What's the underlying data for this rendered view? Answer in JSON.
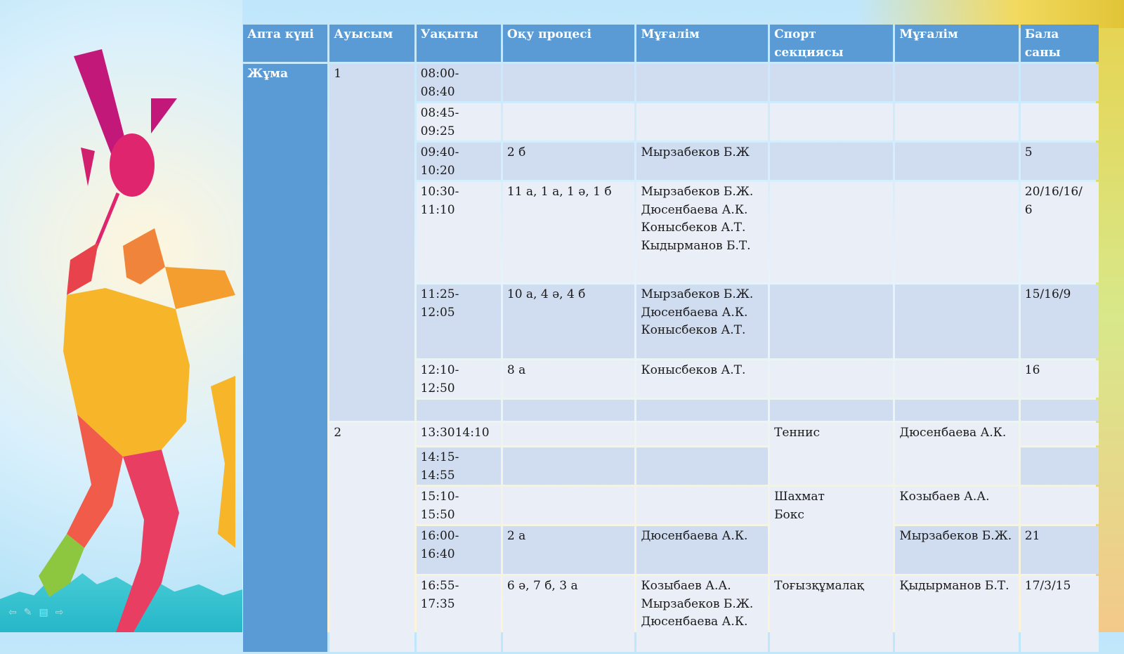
{
  "table": {
    "headers": [
      "Апта күні",
      "Ауысым",
      "Уақыты",
      "Оқу процесі",
      "Мұғалім",
      "Спорт секциясы",
      "Мұғалім",
      "Бала саны"
    ],
    "day": "Жұма",
    "shift1": "1",
    "shift2": "2",
    "rows": [
      {
        "time": "08:00-\n08:40",
        "group": "",
        "teacher": "",
        "count": ""
      },
      {
        "time": "08:45-\n09:25",
        "group": "",
        "teacher": "",
        "count": ""
      },
      {
        "time": "09:40-\n10:20",
        "group": "2 б",
        "teacher": "Мырзабеков Б.Ж",
        "count": "5"
      },
      {
        "time": "10:30-\n11:10",
        "group": "11 а, 1 а, 1 ә, 1 б",
        "teacher": "Мырзабеков Б.Ж.\nДюсенбаева А.К.\nКонысбеков А.Т.\nКыдырманов Б.Т.",
        "count": "20/16/16/\n6"
      },
      {
        "time": "11:25-\n12:05",
        "group": "10 а, 4 ә, 4 б",
        "teacher": "Мырзабеков Б.Ж.\nДюсенбаева А.К.\nКонысбеков А.Т.",
        "count": "15/16/9"
      },
      {
        "time": "12:10-\n12:50",
        "group": "8 а",
        "teacher": "Конысбеков А.Т.",
        "count": "16"
      },
      {
        "time": "",
        "group": "",
        "teacher": "",
        "count": ""
      },
      {
        "time": "13:3014:10",
        "group": "",
        "teacher": "",
        "count": ""
      },
      {
        "time": "14:15-\n14:55",
        "group": "",
        "teacher": "",
        "count": ""
      },
      {
        "time": "15:10-\n15:50",
        "group": "",
        "teacher": "",
        "count": ""
      },
      {
        "time": "16:00-\n16:40",
        "group": "2 а",
        "teacher": "Дюсенбаева А.К.",
        "count": "21"
      },
      {
        "time": "16:55-\n17:35",
        "group": "6 ә,  7 б, 3 а",
        "teacher": "Козыбаев А.А.\nМырзабеков Б.Ж.\nДюсенбаева А.К.",
        "count": "17/3/15"
      }
    ],
    "sections": {
      "tennis": "Теннис",
      "tennis_teacher": "Дюсенбаева А.К.",
      "chess_box": "Шахмат\nБокс",
      "chess_teacher": "Козыбаев А.А.",
      "box_teacher": "Мырзабеков Б.Ж.",
      "togyz": "Тоғызқұмалақ",
      "togyz_teacher": "Қыдырманов Б.Т."
    }
  },
  "colors": {
    "header": "#5b9bd5",
    "row_dark": "#d0dcef",
    "row_light": "#e9eef7"
  },
  "icons": [
    "badminton-player-icon",
    "shuttlecock-icon",
    "racket-icon"
  ]
}
